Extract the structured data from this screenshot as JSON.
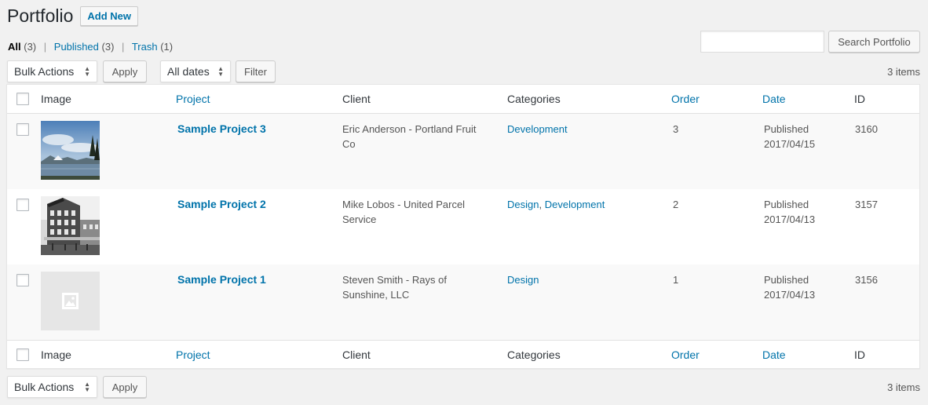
{
  "header": {
    "title": "Portfolio",
    "add_new": "Add New"
  },
  "views": {
    "all": {
      "label": "All",
      "count": "(3)"
    },
    "published": {
      "label": "Published",
      "count": "(3)"
    },
    "trash": {
      "label": "Trash",
      "count": "(1)"
    },
    "separator": "|"
  },
  "search": {
    "button": "Search Portfolio",
    "value": ""
  },
  "tablenav_top": {
    "bulk_actions": "Bulk Actions",
    "apply": "Apply",
    "dates": "All dates",
    "filter": "Filter",
    "items": "3 items"
  },
  "tablenav_bottom": {
    "bulk_actions": "Bulk Actions",
    "apply": "Apply",
    "items": "3 items"
  },
  "columns": {
    "image": "Image",
    "project": "Project",
    "client": "Client",
    "categories": "Categories",
    "order": "Order",
    "date": "Date",
    "id": "ID"
  },
  "rows": [
    {
      "title": "Sample Project 3",
      "client_line1": "Eric Anderson - Portland Fruit",
      "client_line2": "Co",
      "categories": [
        "Development"
      ],
      "order": "3",
      "status": "Published",
      "date": "2017/04/15",
      "id": "3160",
      "thumbnail": "landscape-lake-photo"
    },
    {
      "title": "Sample Project 2",
      "client_line1": "Mike Lobos - United Parcel",
      "client_line2": "Service",
      "categories": [
        "Design",
        "Development"
      ],
      "category_sep": ",",
      "order": "2",
      "status": "Published",
      "date": "2017/04/13",
      "id": "3157",
      "thumbnail": "bw-building-photo"
    },
    {
      "title": "Sample Project 1",
      "client_line1": "Steven Smith - Rays of",
      "client_line2": "Sunshine, LLC",
      "categories": [
        "Design"
      ],
      "order": "1",
      "status": "Published",
      "date": "2017/04/13",
      "id": "3156",
      "thumbnail": "placeholder-image"
    }
  ],
  "colors": {
    "link": "#0073aa",
    "background": "#f1f1f1",
    "row_alt": "#f9f9f9"
  }
}
